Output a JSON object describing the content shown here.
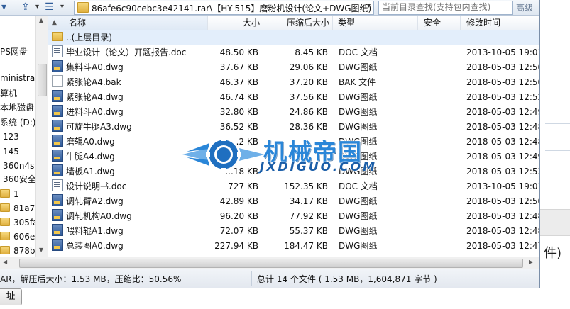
{
  "path": "86afe6c90cebc3e42141.rar\\【HY-515】磨粉机设计(论文+DWG图纸)",
  "search_placeholder": "当前目录查找(支持包内查找)",
  "advanced_label": "高级",
  "tree": [
    "PS网盘",
    "ministrat",
    "算机",
    "本地磁盘",
    "系统 (D:)",
    "123",
    "145",
    "360n4s",
    "360安全",
    "1",
    "81a7a",
    "305fa",
    "606e4",
    "878b3"
  ],
  "columns": {
    "name": "名称",
    "size": "大小",
    "compressed": "压缩后大小",
    "type": "类型",
    "security": "安全",
    "modified": "修改时间"
  },
  "parent_label": "..(上层目录)",
  "files": [
    {
      "icon": "doc-file-icon",
      "name": "毕业设计（论文）开题报告.doc",
      "size": "48.50 KB",
      "comp": "8.45 KB",
      "type": "DOC 文档",
      "time": "2013-10-05 19:01"
    },
    {
      "icon": "dwg-file-icon",
      "name": "集料斗A0.dwg",
      "size": "37.67 KB",
      "comp": "29.06 KB",
      "type": "DWG图纸",
      "time": "2018-05-03 12:50"
    },
    {
      "icon": "bak-file-icon",
      "name": "紧张轮A4.bak",
      "size": "46.37 KB",
      "comp": "37.20 KB",
      "type": "BAK 文件",
      "time": "2018-05-03 12:50"
    },
    {
      "icon": "dwg-file-icon",
      "name": "紧张轮A4.dwg",
      "size": "46.74 KB",
      "comp": "37.56 KB",
      "type": "DWG图纸",
      "time": "2018-05-03 12:52"
    },
    {
      "icon": "dwg-file-icon",
      "name": "进料斗A0.dwg",
      "size": "32.80 KB",
      "comp": "24.86 KB",
      "type": "DWG图纸",
      "time": "2018-05-03 12:49"
    },
    {
      "icon": "dwg-file-icon",
      "name": "可旋牛腿A3.dwg",
      "size": "36.52 KB",
      "comp": "28.36 KB",
      "type": "DWG图纸",
      "time": "2018-05-03 12:48"
    },
    {
      "icon": "dwg-file-icon",
      "name": "磨辊A0.dwg",
      "size": "...2 KB",
      "comp": "",
      "type": "DWG图纸",
      "time": "2018-05-03 12:48"
    },
    {
      "icon": "dwg-file-icon",
      "name": "牛腿A4.dwg",
      "size": "",
      "comp": "",
      "type": "DWG图纸",
      "time": "2018-05-03 12:49"
    },
    {
      "icon": "dwg-file-icon",
      "name": "墙板A1.dwg",
      "size": "...18 KB",
      "comp": "",
      "type": "DWG图纸",
      "time": "2018-05-03 12:52"
    },
    {
      "icon": "doc-file-icon",
      "name": "设计说明书.doc",
      "size": "727 KB",
      "comp": "152.35 KB",
      "type": "DOC 文档",
      "time": "2013-10-05 19:01"
    },
    {
      "icon": "dwg-file-icon",
      "name": "调轧臂A2.dwg",
      "size": "42.89 KB",
      "comp": "34.17 KB",
      "type": "DWG图纸",
      "time": "2018-05-03 12:50"
    },
    {
      "icon": "dwg-file-icon",
      "name": "调轧机构A0.dwg",
      "size": "96.20 KB",
      "comp": "77.92 KB",
      "type": "DWG图纸",
      "time": "2018-05-03 12:48"
    },
    {
      "icon": "dwg-file-icon",
      "name": "喂料辊A1.dwg",
      "size": "72.07 KB",
      "comp": "55.37 KB",
      "type": "DWG图纸",
      "time": "2018-05-03 12:48"
    },
    {
      "icon": "dwg-file-icon",
      "name": "总装图A0.dwg",
      "size": "227.94 KB",
      "comp": "184.47 KB",
      "type": "DWG图纸",
      "time": "2018-05-03 12:47"
    }
  ],
  "watermark": {
    "cn": "机械帝国",
    "en": "JXDIGUO.COM"
  },
  "status": {
    "left": "AR，解压后大小：1.53 MB，压缩比：50.56%",
    "right": "总计 14 个文件 ( 1.53 MB，1,604,871 字节 )"
  },
  "bg_text": "件)",
  "under_button": "址"
}
